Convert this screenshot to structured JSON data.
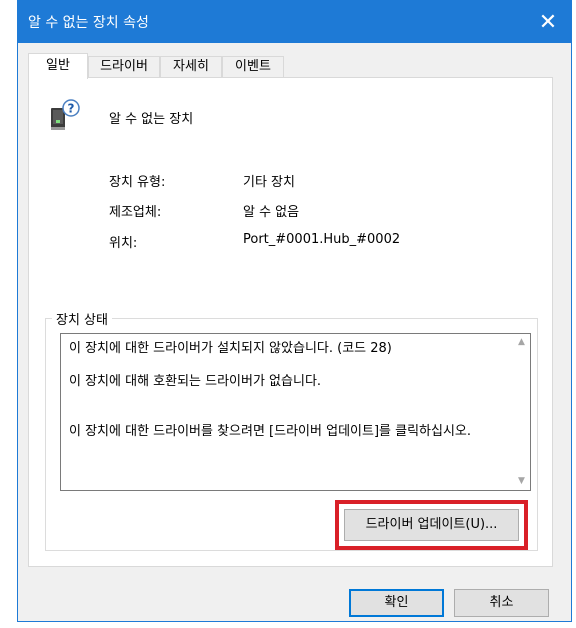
{
  "window": {
    "title": "알 수 없는 장치 속성",
    "close_glyph": "✕",
    "title_bar_color": "#1e7ad6"
  },
  "tabs": [
    {
      "label": "일반",
      "active": true
    },
    {
      "label": "드라이버",
      "active": false
    },
    {
      "label": "자세히",
      "active": false
    },
    {
      "label": "이벤트",
      "active": false
    }
  ],
  "device": {
    "icon": "unknown-device-icon",
    "name": "알 수 없는 장치",
    "properties": [
      {
        "label": "장치 유형:",
        "value": "기타 장치"
      },
      {
        "label": "제조업체:",
        "value": "알 수 없음"
      },
      {
        "label": "위치:",
        "value": "Port_#0001.Hub_#0002"
      }
    ]
  },
  "status": {
    "legend": "장치 상태",
    "lines": [
      "이 장치에 대한 드라이버가 설치되지 않았습니다. (코드 28)",
      "이 장치에 대해 호환되는 드라이버가 없습니다.",
      "이 장치에 대한 드라이버를 찾으려면 [드라이버 업데이트]를 클릭하십시오."
    ]
  },
  "buttons": {
    "update_driver": "드라이버 업데이트(U)...",
    "ok": "확인",
    "cancel": "취소"
  },
  "highlight_color": "#d92028"
}
